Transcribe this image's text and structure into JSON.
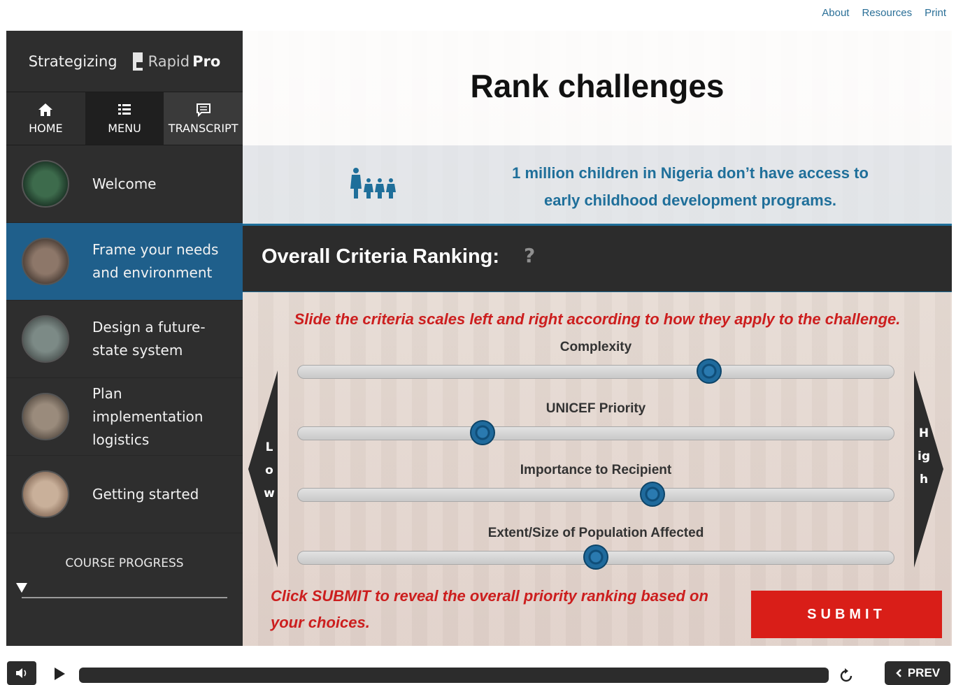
{
  "top_links": [
    "About",
    "Resources",
    "Print"
  ],
  "sidebar": {
    "brand_title": "Strategizing",
    "logo_rapid": "Rapid",
    "logo_pro": "Pro",
    "tabs": [
      {
        "label": "HOME",
        "icon": "home-icon"
      },
      {
        "label": "MENU",
        "icon": "list-icon"
      },
      {
        "label": "TRANSCRIPT",
        "icon": "chat-icon"
      }
    ],
    "items": [
      {
        "label": "Welcome",
        "active": false
      },
      {
        "label": "Frame your needs and environment",
        "active": true
      },
      {
        "label": "Design a future-state system",
        "active": false
      },
      {
        "label": "Plan implementation logistics",
        "active": false
      },
      {
        "label": "Getting started",
        "active": false
      }
    ],
    "progress_label": "COURSE PROGRESS"
  },
  "main": {
    "title": "Rank challenges",
    "stat_text": "1 million children in Nigeria don’t have access to early childhood development programs.",
    "ranking_title": "Overall Criteria Ranking:",
    "ranking_help": "?",
    "instruction": "Slide the criteria scales left and right according to how they apply to the challenge.",
    "low_label": "Low",
    "high_label": "High",
    "sliders": [
      {
        "label": "Complexity",
        "value": 0.69
      },
      {
        "label": "UNICEF Priority",
        "value": 0.31
      },
      {
        "label": "Importance to Recipient",
        "value": 0.595
      },
      {
        "label": "Extent/Size of Population Affected",
        "value": 0.5
      }
    ],
    "submit_note": "Click SUBMIT to reveal the overall priority ranking based on your choices.",
    "submit_label": "SUBMIT"
  },
  "player": {
    "prev_label": "PREV"
  },
  "colors": {
    "accent_blue": "#1f6f9a",
    "active_item": "#1f5f8b",
    "sidebar_bg": "#2e2e2e",
    "alert_red": "#cc1e1e",
    "submit_bg": "#d91e18"
  }
}
